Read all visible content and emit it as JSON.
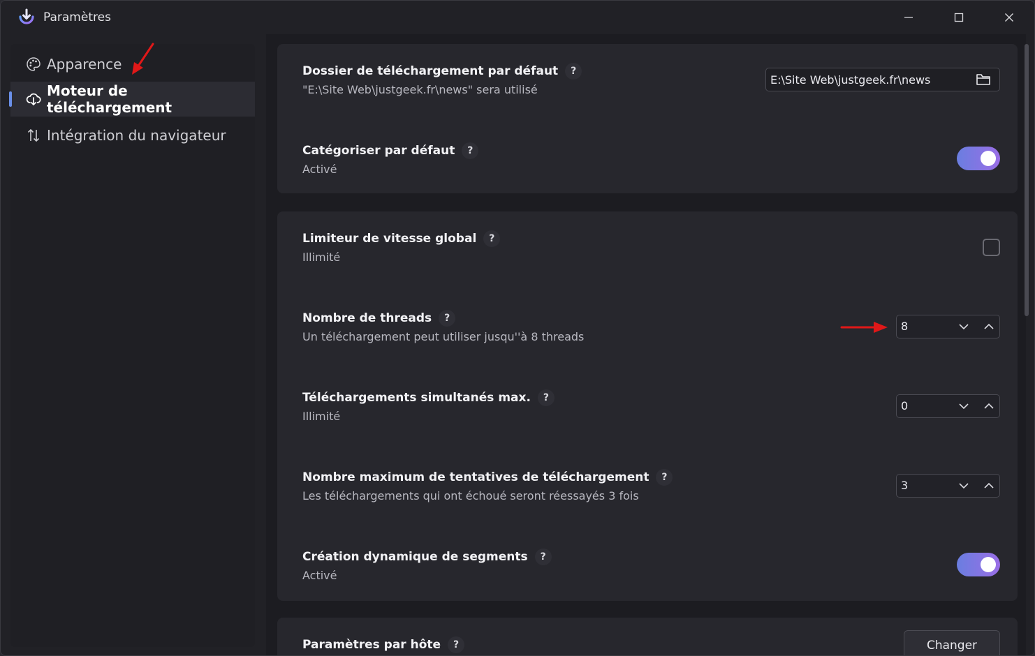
{
  "window": {
    "title": "Paramètres",
    "accent_color": "#6a8fe8",
    "toggle_gradient": [
      "#6a7ee0",
      "#9a6ee6"
    ]
  },
  "sidebar": {
    "items": [
      {
        "label": "Apparence",
        "icon": "palette-icon",
        "active": false
      },
      {
        "label": "Moteur de téléchargement",
        "icon": "cloud-download-icon",
        "active": true
      },
      {
        "label": "Intégration du navigateur",
        "icon": "up-down-arrows-icon",
        "active": false
      }
    ]
  },
  "settings": {
    "download_folder": {
      "title": "Dossier de téléchargement par défaut",
      "help": "?",
      "subtitle": "\"E:\\Site Web\\justgeek.fr\\news\" sera utilisé",
      "value": "E:\\Site Web\\justgeek.fr\\news"
    },
    "categorize": {
      "title": "Catégoriser par défaut",
      "help": "?",
      "subtitle": "Activé",
      "enabled": true
    },
    "speed_limiter": {
      "title": "Limiteur de vitesse global",
      "help": "?",
      "subtitle": "Illimité",
      "checked": false
    },
    "threads": {
      "title": "Nombre de threads",
      "help": "?",
      "subtitle": "Un téléchargement peut utiliser jusqu''à 8 threads",
      "value": "8"
    },
    "max_simultaneous": {
      "title": "Téléchargements simultanés max.",
      "help": "?",
      "subtitle": "Illimité",
      "value": "0"
    },
    "max_retries": {
      "title": "Nombre maximum de tentatives de téléchargement",
      "help": "?",
      "subtitle": "Les téléchargements qui ont échoué seront réessayés 3 fois",
      "value": "3"
    },
    "dynamic_segments": {
      "title": "Création dynamique de segments",
      "help": "?",
      "subtitle": "Activé",
      "enabled": true
    },
    "per_host": {
      "title": "Paramètres par hôte",
      "help": "?",
      "button_label": "Changer"
    }
  }
}
